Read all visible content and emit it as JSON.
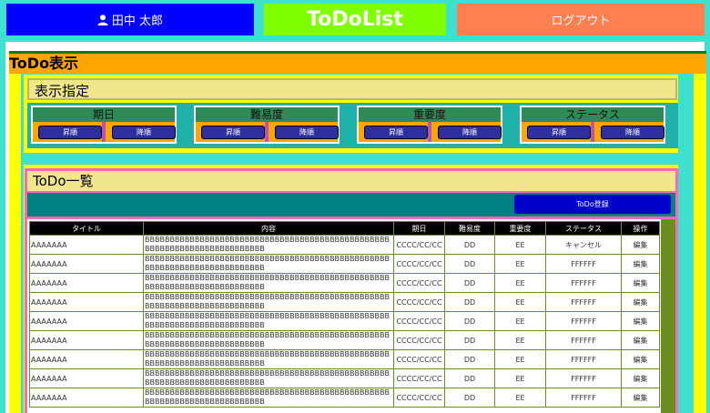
{
  "header": {
    "user_name": "田中 太郎",
    "app_title": "ToDoList",
    "logout_label": "ログアウト"
  },
  "section": {
    "title": "ToDo表示"
  },
  "sort": {
    "title": "表示指定",
    "groups": [
      {
        "label": "期日",
        "asc": "昇順",
        "desc": "降順"
      },
      {
        "label": "難易度",
        "asc": "昇順",
        "desc": "降順"
      },
      {
        "label": "重要度",
        "asc": "昇順",
        "desc": "降順"
      },
      {
        "label": "ステータス",
        "asc": "昇順",
        "desc": "降順"
      }
    ]
  },
  "list": {
    "title": "ToDo一覧",
    "register_label": "ToDo登録",
    "columns": [
      "タイトル",
      "内容",
      "期日",
      "難易度",
      "重要度",
      "ステータス",
      "操作"
    ],
    "rows": [
      {
        "title": "AAAAAAA",
        "content": "BBBBBBBBBBBBBBBBBBBBBBBBBBBBBBBBBBBBBBBBBBBBBBBBBBBBBBBBBBBBBBBBBBBBBBBBB",
        "due": "CCCC/CC/CC",
        "difficulty": "DD",
        "importance": "EE",
        "status": "キャンセル",
        "action": "編集"
      },
      {
        "title": "AAAAAAA",
        "content": "BBBBBBBBBBBBBBBBBBBBBBBBBBBBBBBBBBBBBBBBBBBBBBBBBBBBBBBBBBBBBBBBBBBBBBBBB",
        "due": "CCCC/CC/CC",
        "difficulty": "DD",
        "importance": "EE",
        "status": "FFFFFF",
        "action": "編集"
      },
      {
        "title": "AAAAAAA",
        "content": "BBBBBBBBBBBBBBBBBBBBBBBBBBBBBBBBBBBBBBBBBBBBBBBBBBBBBBBBBBBBBBBBBBBBBBBBB",
        "due": "CCCC/CC/CC",
        "difficulty": "DD",
        "importance": "EE",
        "status": "FFFFFF",
        "action": "編集"
      },
      {
        "title": "AAAAAAA",
        "content": "BBBBBBBBBBBBBBBBBBBBBBBBBBBBBBBBBBBBBBBBBBBBBBBBBBBBBBBBBBBBBBBBBBBBBBBBB",
        "due": "CCCC/CC/CC",
        "difficulty": "DD",
        "importance": "EE",
        "status": "FFFFFF",
        "action": "編集"
      },
      {
        "title": "AAAAAAA",
        "content": "BBBBBBBBBBBBBBBBBBBBBBBBBBBBBBBBBBBBBBBBBBBBBBBBBBBBBBBBBBBBBBBBBBBBBBBBB",
        "due": "CCCC/CC/CC",
        "difficulty": "DD",
        "importance": "EE",
        "status": "FFFFFF",
        "action": "編集"
      },
      {
        "title": "AAAAAAA",
        "content": "BBBBBBBBBBBBBBBBBBBBBBBBBBBBBBBBBBBBBBBBBBBBBBBBBBBBBBBBBBBBBBBBBBBBBBBBB",
        "due": "CCCC/CC/CC",
        "difficulty": "DD",
        "importance": "EE",
        "status": "FFFFFF",
        "action": "編集"
      },
      {
        "title": "AAAAAAA",
        "content": "BBBBBBBBBBBBBBBBBBBBBBBBBBBBBBBBBBBBBBBBBBBBBBBBBBBBBBBBBBBBBBBBBBBBBBBBB",
        "due": "CCCC/CC/CC",
        "difficulty": "DD",
        "importance": "EE",
        "status": "FFFFFF",
        "action": "編集"
      },
      {
        "title": "AAAAAAA",
        "content": "BBBBBBBBBBBBBBBBBBBBBBBBBBBBBBBBBBBBBBBBBBBBBBBBBBBBBBBBBBBBBBBBBBBBBBBBB",
        "due": "CCCC/CC/CC",
        "difficulty": "DD",
        "importance": "EE",
        "status": "FFFFFF",
        "action": "編集"
      },
      {
        "title": "AAAAAAA",
        "content": "BBBBBBBBBBBBBBBBBBBBBBBBBBBBBBBBBBBBBBBBBBBBBBBBBBBBBBBBBBBBBBBBBBBBBBBBB",
        "due": "CCCC/CC/CC",
        "difficulty": "DD",
        "importance": "EE",
        "status": "FFFFFF",
        "action": "編集"
      }
    ]
  },
  "icons": {
    "user": "user-icon"
  },
  "colors": {
    "accent": "#0000ff",
    "title_bg": "#7fff00",
    "logout_bg": "#ff7f50",
    "page_bg": "#40e0d0"
  }
}
